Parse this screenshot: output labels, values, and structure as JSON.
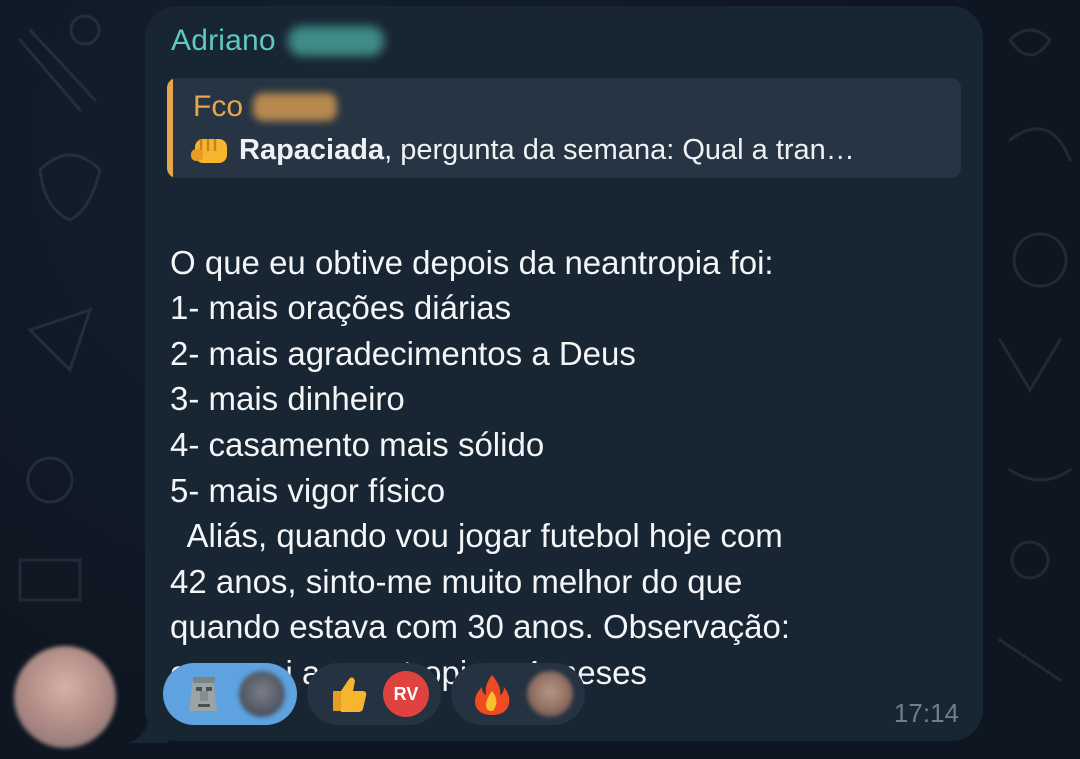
{
  "message": {
    "sender_name": "Adriano",
    "reply": {
      "author": "Fco",
      "emoji_icon": "fist-bump-emoji",
      "bold_text": "Rapaciada",
      "rest_text": ", pergunta da semana:  Qual a tran…"
    },
    "body_lines": [
      "O que eu obtive depois da neantropia foi:",
      "1- mais orações diárias",
      "2- mais agradecimentos a Deus",
      "3- mais dinheiro",
      "4- casamento mais sólido",
      "5- mais vigor físico",
      "  Aliás, quando vou jogar futebol hoje com",
      "42 anos, sinto-me muito melhor do que",
      "quando estava com 30 anos. Observação:",
      "comecei a neantropia a 4 meses"
    ],
    "time": "17:14",
    "reactions": [
      {
        "emoji": "moai-emoji",
        "state": "active"
      },
      {
        "emoji": "thumbs-up-emoji",
        "state": "normal",
        "badge": "RV"
      },
      {
        "emoji": "fire-emoji",
        "state": "normal"
      }
    ]
  },
  "colors": {
    "background": "#0e1621",
    "bubble": "#182533",
    "sender": "#5fc8bf",
    "reply_accent": "#e8a64c",
    "active_reaction": "#5ea2df",
    "time": "#6d7f8f"
  }
}
